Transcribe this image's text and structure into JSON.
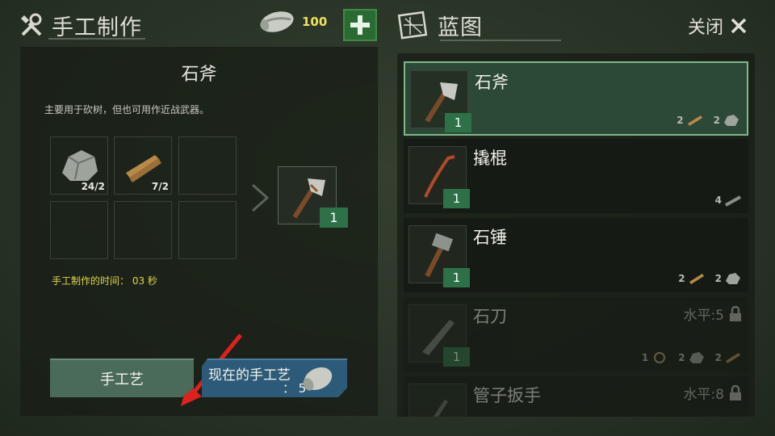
{
  "header": {
    "craft_title": "手工制作",
    "currency_amount": "100",
    "blueprint_title": "蓝图",
    "close_label": "关闭"
  },
  "detail": {
    "item_name": "石斧",
    "description": "主要用于砍树，但也可用作近战武器。",
    "ingredients": [
      {
        "icon": "stone-icon",
        "count": "24/2"
      },
      {
        "icon": "wood-plank-icon",
        "count": "7/2"
      }
    ],
    "result_count": "1",
    "craft_time_label": "手工制作的时间： 03 秒"
  },
  "buttons": {
    "craft_label": "手工艺",
    "craft_now_label": "现在的手工艺",
    "craft_now_value": "： 5"
  },
  "blueprints": [
    {
      "name": "石斧",
      "count": "1",
      "selected": true,
      "reqs": [
        {
          "icon": "wood-plank-icon",
          "n": "2"
        },
        {
          "icon": "stone-icon",
          "n": "2"
        }
      ]
    },
    {
      "name": "撬棍",
      "count": "1",
      "selected": false,
      "reqs": [
        {
          "icon": "metal-pipe-icon",
          "n": "4"
        }
      ]
    },
    {
      "name": "石锤",
      "count": "1",
      "selected": false,
      "reqs": [
        {
          "icon": "wood-plank-icon",
          "n": "2"
        },
        {
          "icon": "stone-icon",
          "n": "2"
        }
      ]
    },
    {
      "name": "石刀",
      "count": "1",
      "locked": true,
      "level": "水平:5",
      "reqs": [
        {
          "icon": "rope-icon",
          "n": "1"
        },
        {
          "icon": "stone-icon",
          "n": "2"
        },
        {
          "icon": "wood-plank-icon",
          "n": "2"
        }
      ]
    },
    {
      "name": "管子扳手",
      "locked": true,
      "level": "水平:8"
    }
  ]
}
